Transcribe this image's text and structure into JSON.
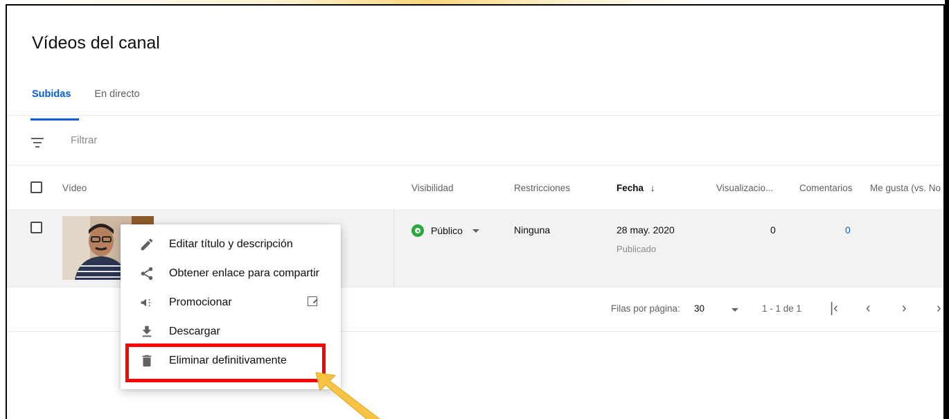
{
  "page": {
    "title": "Vídeos del canal"
  },
  "tabs": [
    {
      "label": "Subidas",
      "active": true
    },
    {
      "label": "En directo",
      "active": false
    }
  ],
  "filter": {
    "placeholder": "Filtrar"
  },
  "table": {
    "headers": {
      "video": "Vídeo",
      "visibility": "Visibilidad",
      "restrictions": "Restricciones",
      "date": "Fecha",
      "views": "Visualizacio...",
      "comments": "Comentarios",
      "likes": "Me gusta (vs. No"
    },
    "sort_arrow": "↓",
    "rows": [
      {
        "visibility": "Público",
        "restrictions": "Ninguna",
        "date": "28 may. 2020",
        "date_status": "Publicado",
        "views": "0",
        "comments": "0"
      }
    ]
  },
  "pager": {
    "rows_label": "Filas por página:",
    "rows_value": "30",
    "range": "1 - 1 de 1",
    "first": "|‹",
    "prev": "‹",
    "next": "›",
    "last": "›"
  },
  "context_menu": {
    "items": [
      {
        "label": "Editar título y descripción",
        "icon": "pencil-icon"
      },
      {
        "label": "Obtener enlace para compartir",
        "icon": "share-icon"
      },
      {
        "label": "Promocionar",
        "icon": "megaphone-icon",
        "external": true
      },
      {
        "label": "Descargar",
        "icon": "download-icon"
      },
      {
        "label": "Eliminar definitivamente",
        "icon": "trash-icon",
        "highlighted": true
      }
    ]
  },
  "colors": {
    "accent": "#065fd4",
    "public_green": "#2ba640",
    "highlight_red": "#ff0000",
    "arrow_yellow": "#f6c343"
  }
}
